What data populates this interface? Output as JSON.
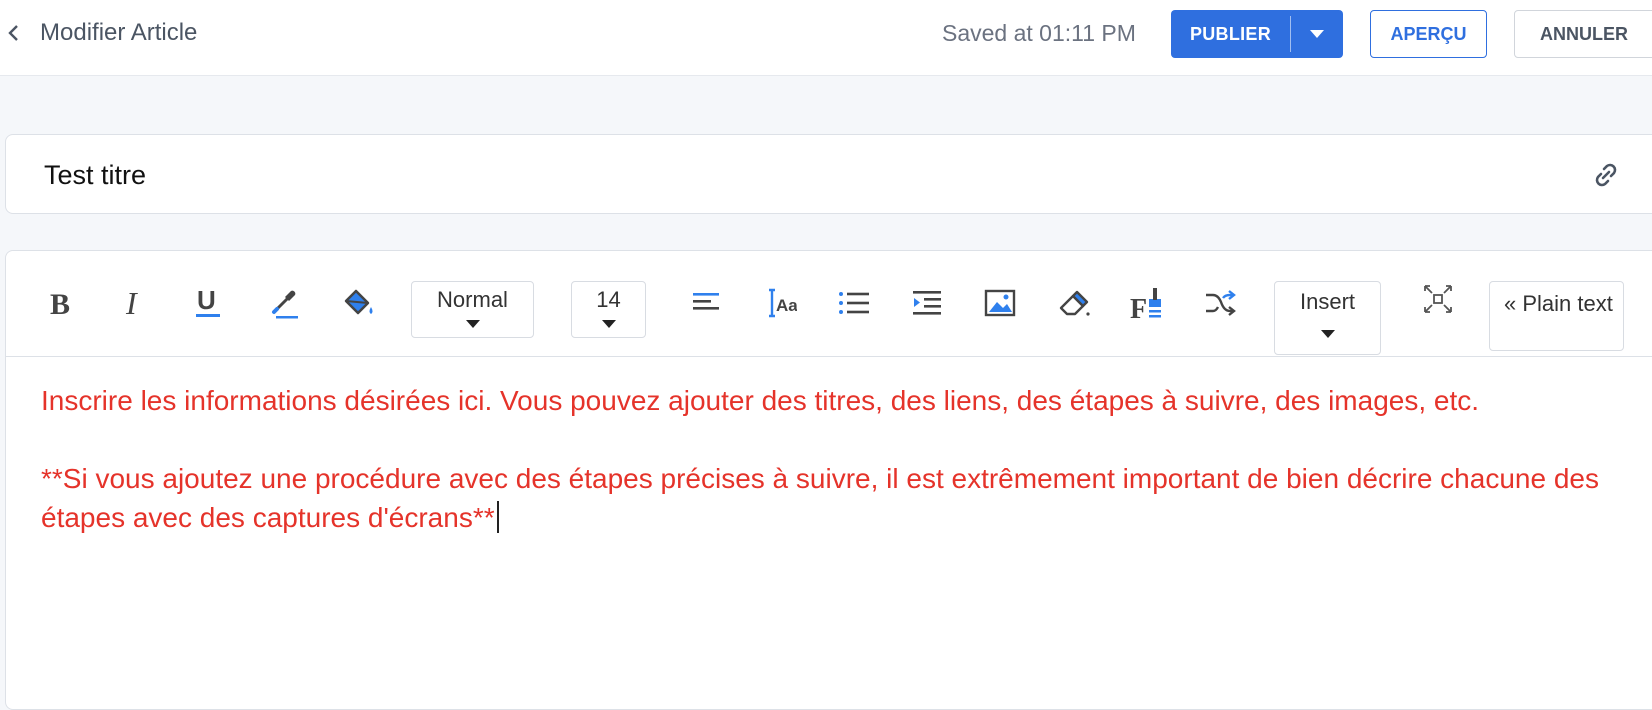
{
  "header": {
    "title": "Modifier Article",
    "saved_status": "Saved at 01:11 PM",
    "publish_label": "PUBLIER",
    "preview_label": "APERÇU",
    "cancel_label": "ANNULER"
  },
  "article": {
    "title_value": "Test titre"
  },
  "toolbar": {
    "paragraph_style": "Normal",
    "font_size": "14",
    "insert_label": "Insert",
    "plain_text_label": "« Plain text"
  },
  "editor": {
    "paragraph_1": "Inscrire les informations désirées ici. Vous pouvez ajouter des titres, des liens, des étapes à suivre, des images, etc.",
    "paragraph_2": "**Si vous ajoutez une procédure avec des étapes précises à suivre, il est extrêmement important de bien décrire chacune des étapes avec des captures d'écrans**"
  },
  "colors": {
    "primary": "#2f6fdf",
    "content_text": "#e5332a",
    "icon_blue": "#2f80ed"
  }
}
